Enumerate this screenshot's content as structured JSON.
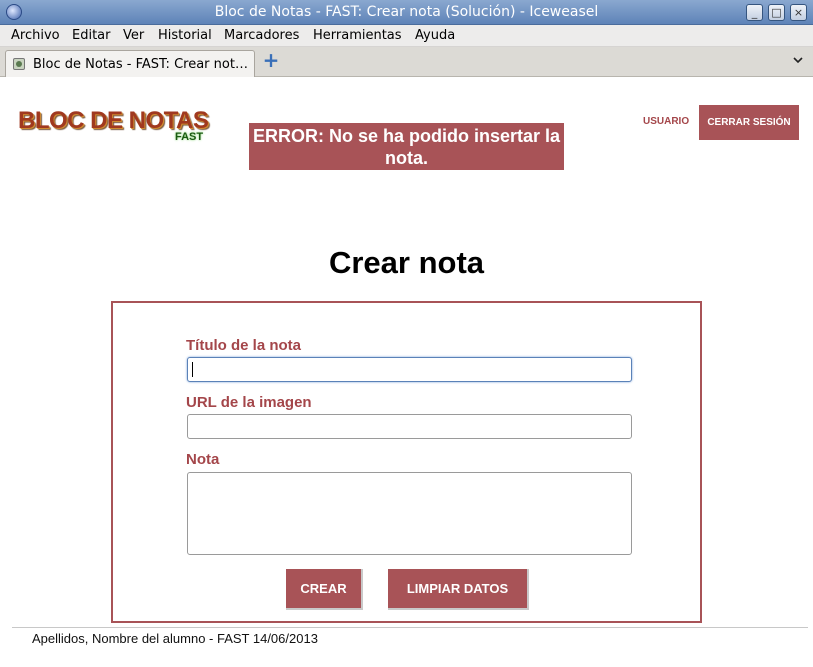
{
  "window": {
    "title": "Bloc de Notas - FAST: Crear nota (Solución) - Iceweasel",
    "buttons": [
      "_",
      "□",
      "×"
    ]
  },
  "menubar": {
    "items": [
      "Archivo",
      "Editar",
      "Ver",
      "Historial",
      "Marcadores",
      "Herramientas",
      "Ayuda"
    ]
  },
  "tabs": {
    "active_label": "Bloc de Notas - FAST: Crear not…",
    "new_tab": "+"
  },
  "header": {
    "logo_main": "BLOC DE NOTAS",
    "logo_sub": "FAST",
    "error": "ERROR: No se ha podido insertar la nota.",
    "user_link": "USUARIO",
    "logout": "CERRAR SESIÓN"
  },
  "main": {
    "title": "Crear nota",
    "fields": {
      "title_label": "Título de la nota",
      "title_value": "",
      "url_label": "URL de la imagen",
      "url_value": "",
      "note_label": "Nota",
      "note_value": ""
    },
    "buttons": {
      "create": "CREAR",
      "clear": "LIMPIAR DATOS"
    }
  },
  "footer": {
    "text": "Apellidos, Nombre del alumno - FAST 14/06/2013"
  },
  "colors": {
    "accent": "#a85357",
    "label": "#a4464a",
    "titlebar": "#6e8fc2"
  }
}
